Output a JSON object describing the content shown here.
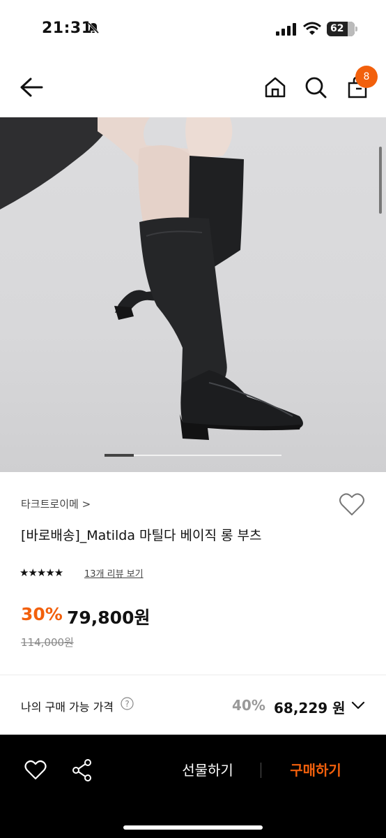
{
  "status_bar": {
    "time": "21:31",
    "battery": "62"
  },
  "header": {
    "cart_count": "8"
  },
  "product": {
    "brand": "타크트로이메 >",
    "title": "[바로배송]_Matilda 마틸다 베이직 롱 부츠",
    "stars": "★★★★★",
    "rating": 5,
    "review_link": "13개 리뷰 보기",
    "discount": "30%",
    "price": "79,800원",
    "original_price": "114,000원"
  },
  "available_price": {
    "label": "나의 구매 가능 가격",
    "discount": "40%",
    "price": "68,229 원"
  },
  "bottom_bar": {
    "gift_label": "선물하기",
    "buy_label": "구매하기"
  },
  "colors": {
    "accent": "#f2600c",
    "bottom_bar": "#000000"
  },
  "icons": [
    "bell-slash-icon",
    "signal-icon",
    "wifi-icon",
    "back-icon",
    "home-icon",
    "search-icon",
    "bag-icon",
    "heart-icon",
    "question-icon",
    "chevron-down-icon",
    "share-icon"
  ]
}
